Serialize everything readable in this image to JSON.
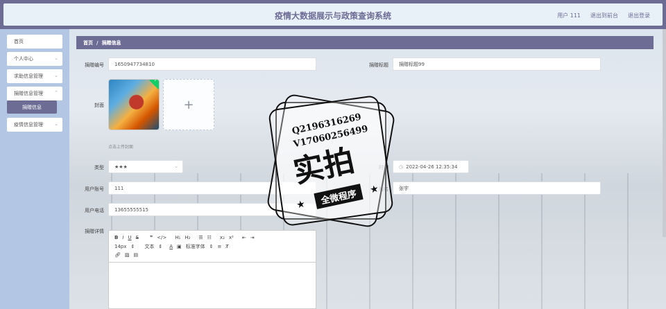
{
  "header": {
    "title": "疫情大数据展示与政策查询系统",
    "user": "用户 111",
    "exit_front": "退出到前台",
    "logout": "退出登录"
  },
  "sidebar": {
    "items": [
      {
        "label": "首页"
      },
      {
        "label": "个人中心"
      },
      {
        "label": "求助信息管理"
      },
      {
        "label": "捐赠信息管理"
      },
      {
        "label": "捐赠信息"
      },
      {
        "label": "疫情信息管理"
      }
    ]
  },
  "breadcrumb": {
    "home": "首页",
    "sep": "/",
    "current": "捐赠信息"
  },
  "form": {
    "donation_no_label": "捐赠编号",
    "donation_no": "1650947734810",
    "donation_title_label": "捐赠标题",
    "donation_title": "捐赠标题99",
    "cover_label": "封面",
    "upload_plus": "+",
    "upload_hint": "点击上传封面",
    "type_label": "类型",
    "type_value": "★★★",
    "time_label": "时间",
    "time_value": "2022-04-26 12:35:34",
    "account_label": "用户账号",
    "account_value": "111",
    "name_label": "姓名",
    "name_value": "张宇",
    "phone_label": "用户电话",
    "phone_value": "13655555515",
    "detail_label": "捐赠详情",
    "editor": {
      "font_size": "14px",
      "text_style": "文本",
      "font_family": "标准字体"
    }
  },
  "stamp": {
    "line1": "Q2196316269",
    "line2": "V17060256499",
    "main": "实拍",
    "sub": "全微程序"
  }
}
